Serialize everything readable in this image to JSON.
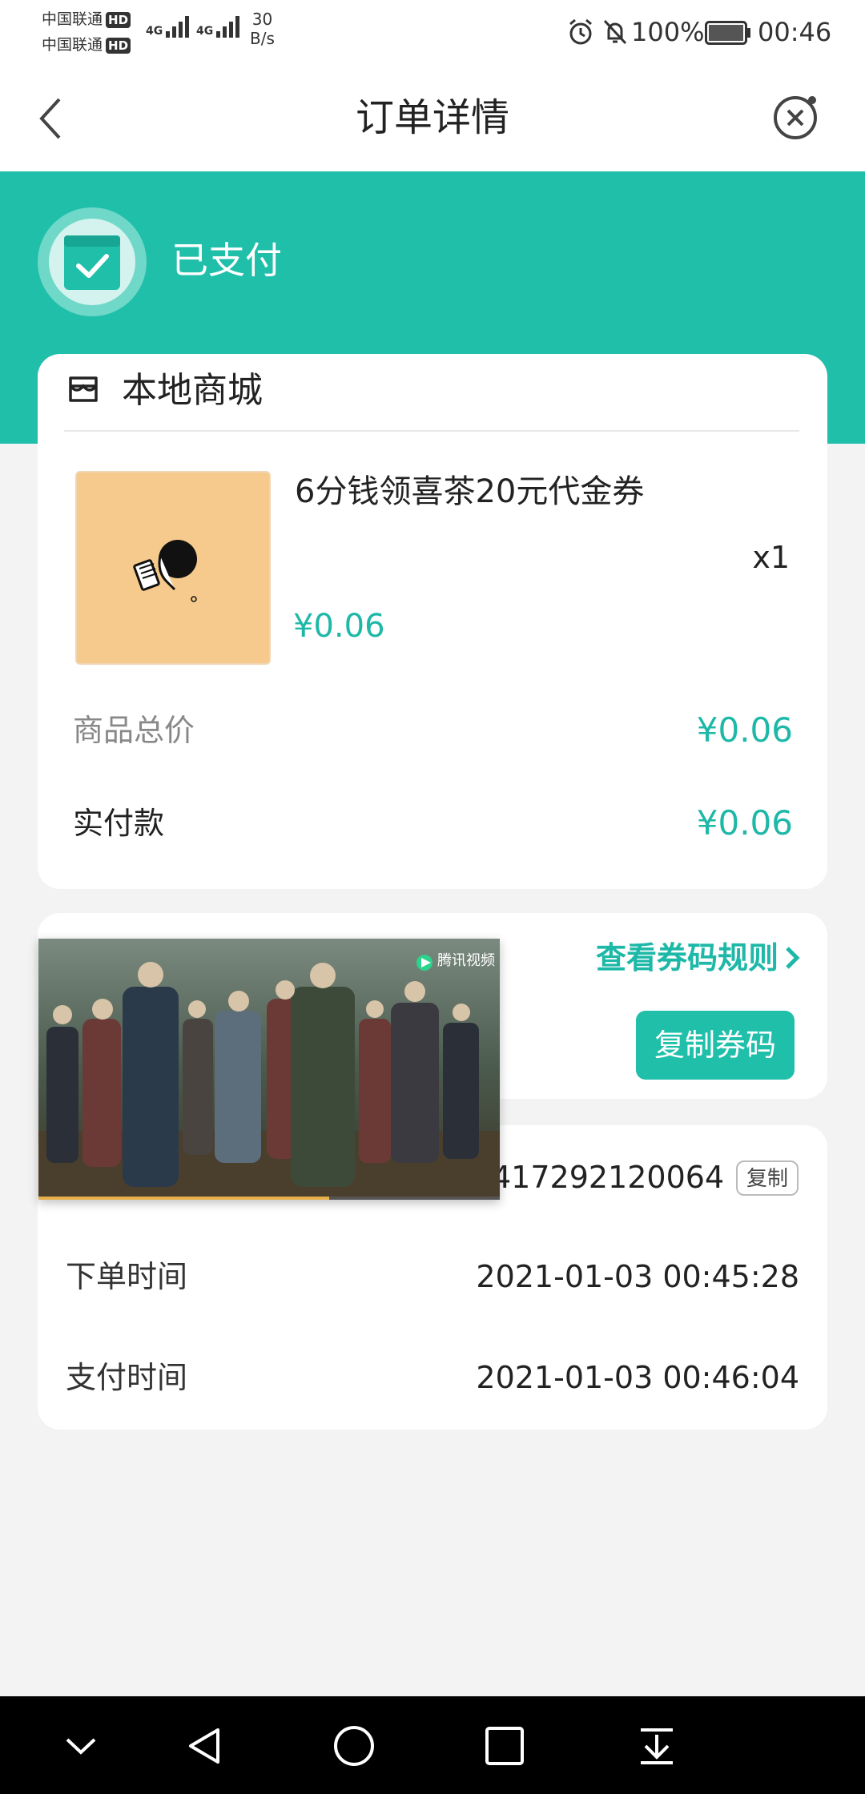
{
  "status_bar": {
    "carrier1": "中国联通",
    "carrier2": "中国联通",
    "hd": "HD",
    "net1": "4G",
    "net2": "4G",
    "speed_value": "30",
    "speed_unit": "B/s",
    "battery": "100%",
    "time": "00:46"
  },
  "header": {
    "title": "订单详情",
    "back_icon": "chevron-left-icon",
    "close_icon": "close-circle-icon"
  },
  "order_status": {
    "text": "已支付",
    "icon": "box-check-icon"
  },
  "shop": {
    "name": "本地商城",
    "icon": "store-icon",
    "product": {
      "name": "6分钱领喜茶20元代金券",
      "quantity": "x1",
      "price": "¥0.06"
    },
    "summary": [
      {
        "label": "商品总价",
        "value": "¥0.06"
      },
      {
        "label": "实付款",
        "value": "¥0.06"
      }
    ]
  },
  "voucher": {
    "rules_link": "查看券码规则",
    "copy_code_button": "复制券码"
  },
  "order_info": {
    "order_number_partial": "417292120064",
    "copy_button": "复制",
    "rows": [
      {
        "label": "下单时间",
        "value": "2021-01-03 00:45:28"
      },
      {
        "label": "支付时间",
        "value": "2021-01-03 00:46:04"
      }
    ]
  },
  "video_overlay": {
    "watermark": "腾讯视频",
    "progress": 0.63
  },
  "colors": {
    "accent": "#1fbfaa",
    "price": "#1db8a7"
  }
}
